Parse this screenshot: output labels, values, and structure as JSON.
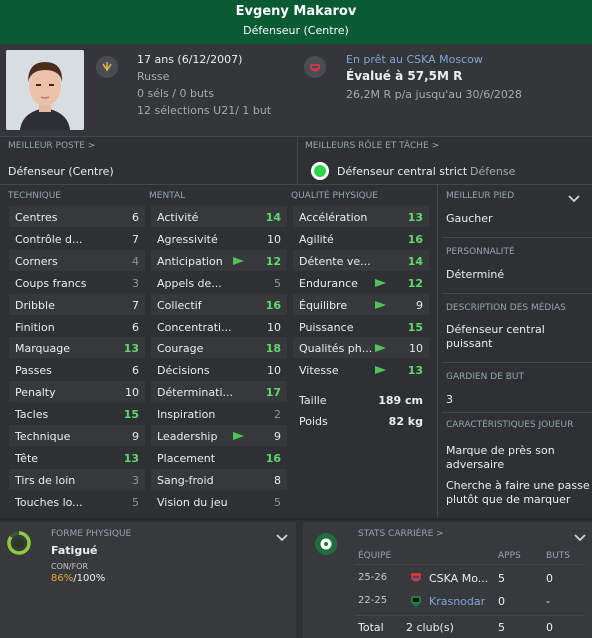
{
  "header": {
    "name": "Evgeny Makarov",
    "position": "Défenseur (Centre)"
  },
  "bio": {
    "age": "17 ans (6/12/2007)",
    "nationality": "Russe",
    "caps": "0 séls / 0 buts",
    "u21": "12 sélections U21/ 1 but"
  },
  "contract": {
    "loan": "En prêt au CSKA Moscow",
    "value": "Évalué à 57,5M R",
    "wage": "26,2M R p/a jusqu'au 30/6/2028"
  },
  "best_position": {
    "label": "MEILLEUR POSTE >",
    "value": "Défenseur (Centre)"
  },
  "best_role": {
    "label": "MEILLEURS RÔLE ET TÂCHE >",
    "role": "Défenseur central strict",
    "duty": "Défense"
  },
  "headers": {
    "technique": "TECHNIQUE",
    "mental": "MENTAL",
    "physical": "QUALITÉ PHYSIQUE"
  },
  "technique": [
    {
      "name": "Centres",
      "value": "6",
      "style": "white"
    },
    {
      "name": "Contrôle d...",
      "value": "7",
      "style": "white"
    },
    {
      "name": "Corners",
      "value": "4",
      "style": "gray"
    },
    {
      "name": "Coups francs",
      "value": "3",
      "style": "gray"
    },
    {
      "name": "Dribble",
      "value": "7",
      "style": "white"
    },
    {
      "name": "Finition",
      "value": "6",
      "style": "white"
    },
    {
      "name": "Marquage",
      "value": "13",
      "style": "green"
    },
    {
      "name": "Passes",
      "value": "6",
      "style": "white"
    },
    {
      "name": "Penalty",
      "value": "10",
      "style": "white"
    },
    {
      "name": "Tacles",
      "value": "15",
      "style": "green"
    },
    {
      "name": "Technique",
      "value": "9",
      "style": "white"
    },
    {
      "name": "Tête",
      "value": "13",
      "style": "green"
    },
    {
      "name": "Tirs de loin",
      "value": "3",
      "style": "gray"
    },
    {
      "name": "Touches lo...",
      "value": "5",
      "style": "gray"
    }
  ],
  "mental": [
    {
      "name": "Activité",
      "value": "14",
      "style": "green",
      "arrow": false
    },
    {
      "name": "Agressivité",
      "value": "10",
      "style": "white",
      "arrow": false
    },
    {
      "name": "Anticipation",
      "value": "12",
      "style": "green",
      "arrow": true
    },
    {
      "name": "Appels de...",
      "value": "5",
      "style": "gray",
      "arrow": false
    },
    {
      "name": "Collectif",
      "value": "16",
      "style": "green",
      "arrow": false
    },
    {
      "name": "Concentrati...",
      "value": "10",
      "style": "white",
      "arrow": false
    },
    {
      "name": "Courage",
      "value": "18",
      "style": "green",
      "arrow": false
    },
    {
      "name": "Décisions",
      "value": "10",
      "style": "white",
      "arrow": false
    },
    {
      "name": "Déterminati...",
      "value": "17",
      "style": "green",
      "arrow": false
    },
    {
      "name": "Inspiration",
      "value": "2",
      "style": "gray",
      "arrow": false
    },
    {
      "name": "Leadership",
      "value": "9",
      "style": "white",
      "arrow": true
    },
    {
      "name": "Placement",
      "value": "16",
      "style": "green",
      "arrow": false
    },
    {
      "name": "Sang-froid",
      "value": "8",
      "style": "white",
      "arrow": false
    },
    {
      "name": "Vision du jeu",
      "value": "5",
      "style": "gray",
      "arrow": false
    }
  ],
  "physical": [
    {
      "name": "Accélération",
      "value": "13",
      "style": "green",
      "arrow": false
    },
    {
      "name": "Agilité",
      "value": "16",
      "style": "green",
      "arrow": false
    },
    {
      "name": "Détente ve...",
      "value": "14",
      "style": "green",
      "arrow": false
    },
    {
      "name": "Endurance",
      "value": "12",
      "style": "green",
      "arrow": true
    },
    {
      "name": "Équilibre",
      "value": "9",
      "style": "white",
      "arrow": true
    },
    {
      "name": "Puissance",
      "value": "15",
      "style": "green",
      "arrow": false
    },
    {
      "name": "Qualités ph...",
      "value": "10",
      "style": "white",
      "arrow": true
    },
    {
      "name": "Vitesse",
      "value": "13",
      "style": "green",
      "arrow": true
    }
  ],
  "body": {
    "height_label": "Taille",
    "height": "189 cm",
    "weight_label": "Poids",
    "weight": "82 kg"
  },
  "side": {
    "foot_label": "MEILLEUR PIED",
    "foot": "Gaucher",
    "personality_label": "PERSONNALITÉ",
    "personality": "Déterminé",
    "media_label": "DESCRIPTION DES MÉDIAS",
    "media": "Défenseur central puissant",
    "gk_label": "GARDIEN DE BUT",
    "gk": "3",
    "traits_label": "CARACTÉRISTIQUES JOUEUR",
    "trait1": "Marque de près son adversaire",
    "trait2": "Cherche à faire une passe plutôt que de marquer"
  },
  "form": {
    "label": "FORME PHYSIQUE",
    "status": "Fatigué",
    "confor_label": "CON/FOR",
    "condition": "86%",
    "sharpness": "/100%"
  },
  "career": {
    "label": "STATS CARRIÈRE >",
    "col_team": "ÉQUIPE",
    "col_apps": "APPS",
    "col_goals": "BUTS",
    "rows": [
      {
        "season": "25-26",
        "team": "CSKA Mo...",
        "apps": "5",
        "goals": "0"
      },
      {
        "season": "22-25",
        "team": "Krasnodar",
        "apps": "0",
        "goals": "-"
      }
    ],
    "total_label": "Total",
    "total_clubs": "2 club(s)",
    "total_apps": "5",
    "total_goals": "0"
  },
  "colors": {
    "header_bg": "#0a5a33",
    "green_value": "#61d86e",
    "accent_arrow": "#4fc35a",
    "link": "#7fa7d6"
  }
}
